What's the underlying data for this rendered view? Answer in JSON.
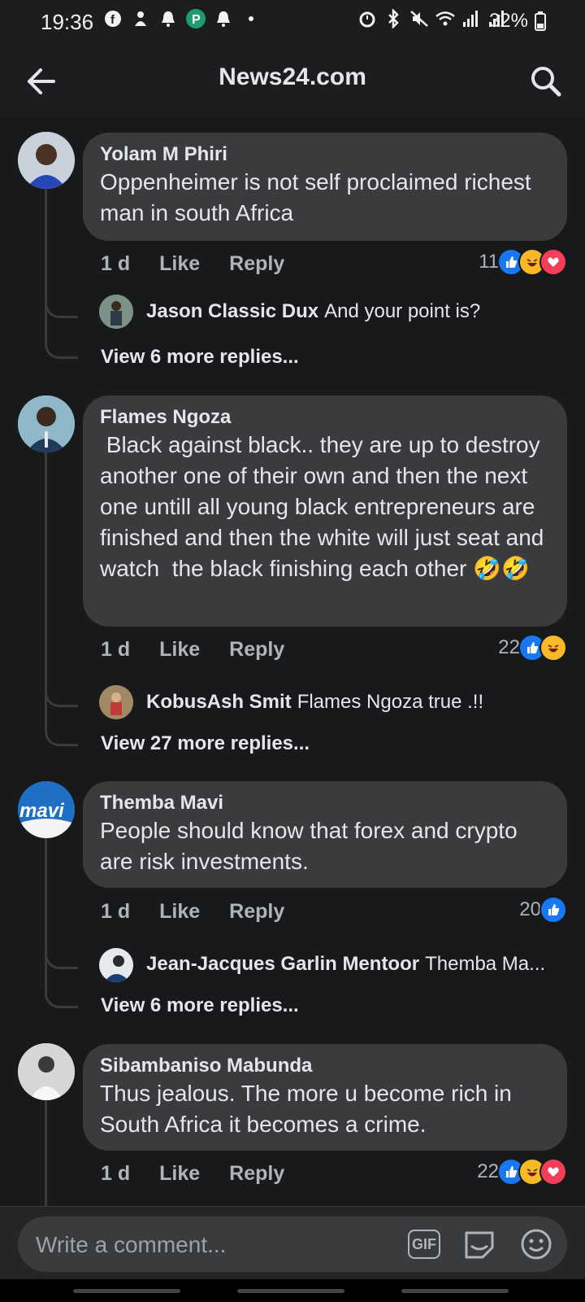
{
  "status_bar": {
    "time": "19:36",
    "battery": "32%"
  },
  "header": {
    "title": "News24.com"
  },
  "comments": [
    {
      "author": "Yolam M Phiri",
      "text": "Oppenheimer is not self proclaimed richest man in south Africa",
      "time": "1 d",
      "like": "Like",
      "reply": "Reply",
      "reaction_count": "11",
      "reactions": [
        "like",
        "haha",
        "love"
      ],
      "preview_reply": {
        "author": "Jason Classic Dux",
        "text": "And your point is?"
      },
      "more": "View 6 more replies..."
    },
    {
      "author": "Flames Ngoza",
      "text": " Black against black.. they are up to destroy another one of their own and then the next one untill all young black entrepreneurs are finished and then the white will just seat and watch  the black finishing each other 🤣🤣",
      "time": "1 d",
      "like": "Like",
      "reply": "Reply",
      "reaction_count": "22",
      "reactions": [
        "like",
        "haha"
      ],
      "preview_reply": {
        "author": "KobusAsh Smit",
        "text": "Flames Ngoza true .!!"
      },
      "more": "View 27 more replies..."
    },
    {
      "author": "Themba Mavi",
      "avatar_text": "mavi",
      "text": "People should know that forex and crypto are risk investments.",
      "time": "1 d",
      "like": "Like",
      "reply": "Reply",
      "reaction_count": "20",
      "reactions": [
        "like"
      ],
      "preview_reply": {
        "author": "Jean-Jacques Garlin Mentoor",
        "text": "Themba Ma..."
      },
      "more": "View 6 more replies..."
    },
    {
      "author": "Sibambaniso Mabunda",
      "text": "Thus jealous. The more u become rich in South Africa it becomes a crime.",
      "time": "1 d",
      "like": "Like",
      "reply": "Reply",
      "reaction_count": "22",
      "reactions": [
        "like",
        "haha",
        "love"
      ]
    }
  ],
  "composer": {
    "placeholder": "Write a comment...",
    "gif": "GIF"
  },
  "colors": {
    "background": "#18191a",
    "bubble": "#3a3b3c",
    "like": "#1877f2",
    "haha": "#f7b928",
    "love": "#f33e58"
  }
}
